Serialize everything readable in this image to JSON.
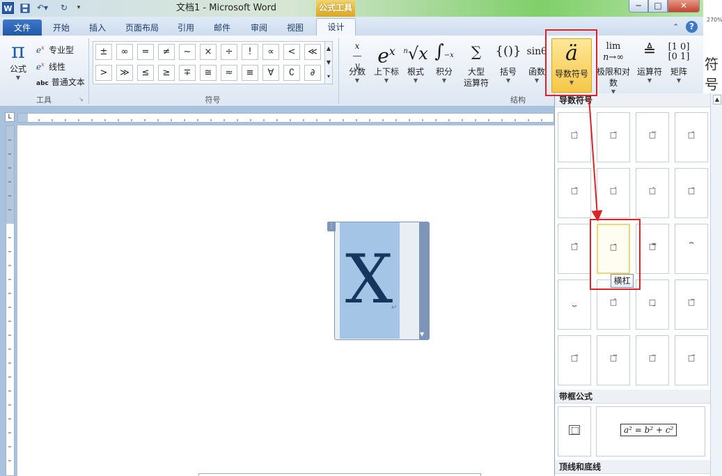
{
  "window": {
    "title": "文档1  -  Microsoft Word",
    "context_tab": "公式工具",
    "app_icon": "W",
    "min": "─",
    "max": "□",
    "close": "✕"
  },
  "tabs": {
    "file": "文件",
    "home": "开始",
    "insert": "插入",
    "layout": "页面布局",
    "refs": "引用",
    "mail": "邮件",
    "review": "审阅",
    "view": "视图",
    "design": "设计"
  },
  "tools": {
    "equation_label": "公式",
    "professional": "专业型",
    "linear": "线性",
    "plain_text": "普通文本",
    "plain_prefix": "abc",
    "group_label": "工具"
  },
  "symbols": {
    "row1": [
      "±",
      "∞",
      "=",
      "≠",
      "~",
      "×",
      "÷",
      "!",
      "∝",
      "<",
      "≪"
    ],
    "row2": [
      ">",
      "≫",
      "≤",
      "≥",
      "∓",
      "≅",
      "≈",
      "≡",
      "∀",
      "∁",
      "∂"
    ],
    "group_label": "符号"
  },
  "structures": {
    "fraction": "分数",
    "script": "上下标",
    "radical": "根式",
    "integral": "积分",
    "large_operator_1": "大型",
    "large_operator_2": "运算符",
    "bracket": "括号",
    "function": "函数",
    "accent": "导数符号",
    "limit_log": "极限和对数",
    "operator": "运算符",
    "matrix": "矩阵",
    "group_label": "结构",
    "function_icon": "sinθ",
    "limit_icon_top": "lim",
    "limit_icon_bottom": "n→∞"
  },
  "gallery": {
    "section_accents": "导数符号",
    "section_boxed": "带框公式",
    "section_overline": "顶线和底线",
    "tooltip": "横杠",
    "boxed_example": "a² = b² + c²"
  },
  "side_text": "符号",
  "zoom_fragment": "270%",
  "colors": {
    "accent_highlight": "#f6c746",
    "file_tab": "#2158a8",
    "annotation_red": "#e02222"
  }
}
